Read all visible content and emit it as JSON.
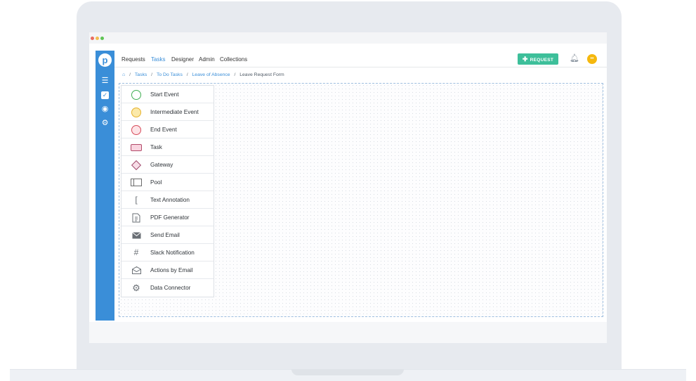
{
  "nav": {
    "items": [
      "Requests",
      "Tasks",
      "Designer",
      "Admin",
      "Collections"
    ],
    "active": "Tasks",
    "request_button": "REQUEST",
    "request_icon": "plus-icon",
    "accent_color": "#3a8ed8",
    "button_color": "#3dbf9a"
  },
  "brand_letter": "p",
  "breadcrumb": {
    "items": [
      "Tasks",
      "To Do Tasks",
      "Leave of Absence",
      "Leave Request Form"
    ],
    "separator": "/"
  },
  "palette": {
    "items": [
      {
        "label": "Start Event",
        "icon": "start-event-icon"
      },
      {
        "label": "Intermediate Event",
        "icon": "intermediate-event-icon"
      },
      {
        "label": "End Event",
        "icon": "end-event-icon"
      },
      {
        "label": "Task",
        "icon": "task-icon"
      },
      {
        "label": "Gateway",
        "icon": "gateway-icon"
      },
      {
        "label": "Pool",
        "icon": "pool-icon"
      },
      {
        "label": "Text Annotation",
        "icon": "text-annotation-icon"
      },
      {
        "label": "PDF Generator",
        "icon": "pdf-generator-icon"
      },
      {
        "label": "Send Email",
        "icon": "send-email-icon"
      },
      {
        "label": "Slack Notification",
        "icon": "slack-icon"
      },
      {
        "label": "Actions by Email",
        "icon": "actions-by-email-icon"
      },
      {
        "label": "Data Connector",
        "icon": "data-connector-icon"
      }
    ]
  }
}
